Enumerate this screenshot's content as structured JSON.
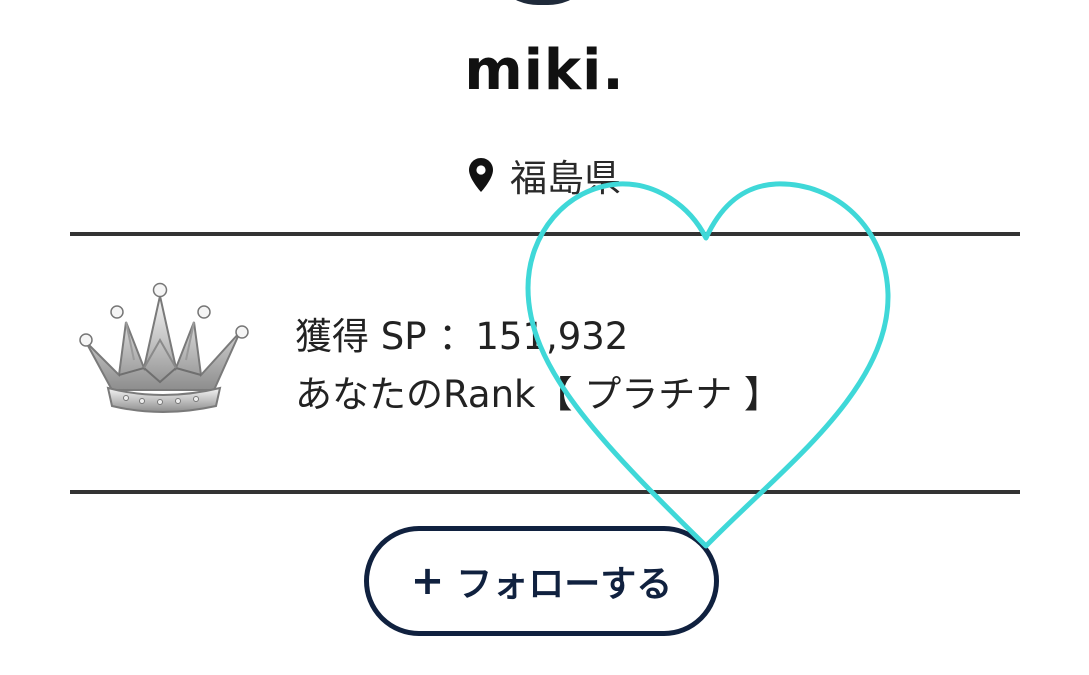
{
  "profile": {
    "name": "miki.",
    "location": "福島県"
  },
  "rank": {
    "sp_line": "獲得 SP ：151,932",
    "rank_line": "あなたのRank【 プラチナ 】"
  },
  "actions": {
    "follow_plus": "+",
    "follow_label": "フォローする"
  },
  "icons": {
    "location": "map-pin-icon",
    "rank_badge": "crown-icon",
    "overlay": "heart-icon"
  },
  "colors": {
    "button_border": "#10213f",
    "divider": "#333333",
    "heart_overlay": "#3fd8d8",
    "crown": "#b8b8b8"
  }
}
